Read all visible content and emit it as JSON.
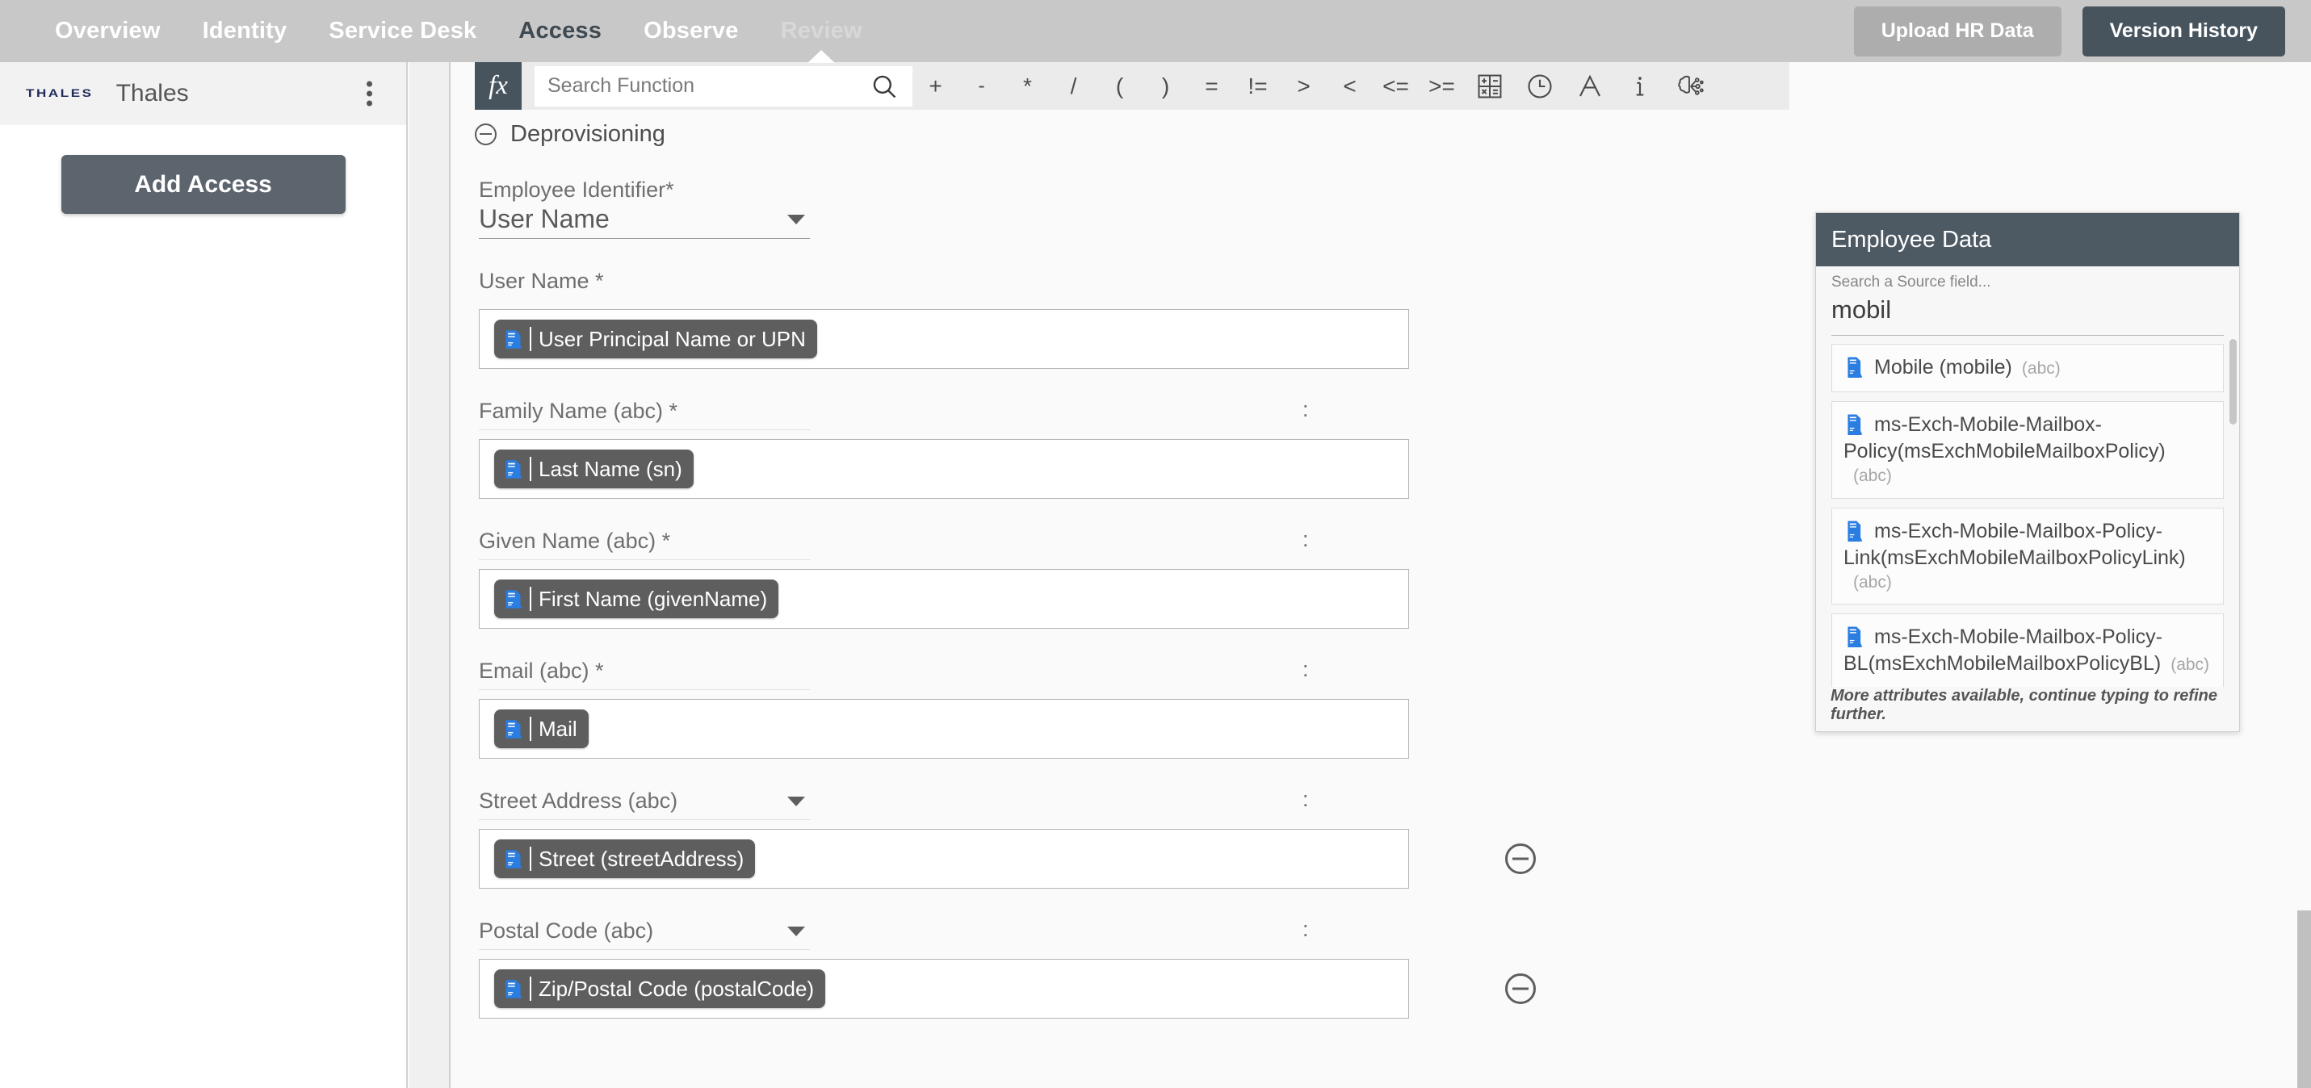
{
  "topnav": {
    "items": [
      {
        "label": "Overview",
        "state": "normal"
      },
      {
        "label": "Identity",
        "state": "normal"
      },
      {
        "label": "Service Desk",
        "state": "normal"
      },
      {
        "label": "Access",
        "state": "active"
      },
      {
        "label": "Observe",
        "state": "normal"
      },
      {
        "label": "Review",
        "state": "dim"
      }
    ],
    "upload_button": "Upload HR Data",
    "version_button": "Version History",
    "bg_color": "#c8c8c8",
    "active_color": "#3f4a52",
    "version_button_color": "#47545e"
  },
  "sidebar": {
    "logo_text": "THALES",
    "logo_color": "#1e2a5a",
    "title": "Thales",
    "menu_icon": "kebab-menu-icon",
    "add_access_button": "Add Access",
    "add_access_color": "#5c656e"
  },
  "toolbar": {
    "fx_label": "fx",
    "search_placeholder": "Search Function",
    "search_value": "",
    "search_icon": "search-icon",
    "operators": [
      "+",
      "-",
      "*",
      "/",
      "(",
      ")",
      "=",
      "!=",
      ">",
      "<",
      "<=",
      ">="
    ],
    "icons": [
      {
        "name": "math-operations-icon"
      },
      {
        "name": "clock-icon"
      },
      {
        "name": "text-format-icon"
      },
      {
        "name": "info-icon"
      },
      {
        "name": "ai-brain-icon"
      }
    ]
  },
  "section": {
    "collapse_icon": "collapse-minus-icon",
    "title": "Deprovisioning"
  },
  "identifier": {
    "label": "Employee Identifier*",
    "value": "User Name",
    "caret_icon": "chevron-down-icon"
  },
  "fields": [
    {
      "label": "User Name *",
      "has_caret": false,
      "has_colon": false,
      "has_remove": false,
      "chip": {
        "icon": "source-attribute-icon",
        "text": "User Principal Name or UPN"
      }
    },
    {
      "label": "Family Name (abc) *",
      "has_caret": false,
      "has_colon": true,
      "colon": ":",
      "has_remove": false,
      "chip": {
        "icon": "source-attribute-icon",
        "text": "Last Name (sn)"
      }
    },
    {
      "label": "Given Name (abc) *",
      "has_caret": false,
      "has_colon": true,
      "colon": ":",
      "has_remove": false,
      "chip": {
        "icon": "source-attribute-icon",
        "text": "First Name (givenName)"
      }
    },
    {
      "label": "Email (abc) *",
      "has_caret": false,
      "has_colon": true,
      "colon": ":",
      "has_remove": false,
      "chip": {
        "icon": "source-attribute-icon",
        "text": "Mail"
      }
    },
    {
      "label": "Street Address (abc)",
      "has_caret": true,
      "has_colon": true,
      "colon": ":",
      "has_remove": true,
      "chip": {
        "icon": "source-attribute-icon",
        "text": "Street (streetAddress)"
      }
    },
    {
      "label": "Postal Code (abc)",
      "has_caret": true,
      "has_colon": true,
      "colon": ":",
      "has_remove": true,
      "chip": {
        "icon": "source-attribute-icon",
        "text": "Zip/Postal Code (postalCode)"
      }
    }
  ],
  "employee_panel": {
    "title": "Employee Data",
    "header_color": "#4e5a63",
    "search_placeholder": "Search a Source field...",
    "search_value": "mobil",
    "items": [
      {
        "name": "Mobile (mobile)",
        "type": "(abc)",
        "icon": "source-attribute-icon"
      },
      {
        "name": "ms-Exch-Mobile-Mailbox-Policy(msExchMobileMailboxPolicy)",
        "type": "(abc)",
        "icon": "source-attribute-icon"
      },
      {
        "name": "ms-Exch-Mobile-Mailbox-Policy-Link(msExchMobileMailboxPolicyLink)",
        "type": "(abc)",
        "icon": "source-attribute-icon"
      },
      {
        "name": "ms-Exch-Mobile-Mailbox-Policy-BL(msExchMobileMailboxPolicyBL)",
        "type": "(abc)",
        "icon": "source-attribute-icon"
      }
    ],
    "footer": "More attributes available, continue typing to refine further."
  }
}
